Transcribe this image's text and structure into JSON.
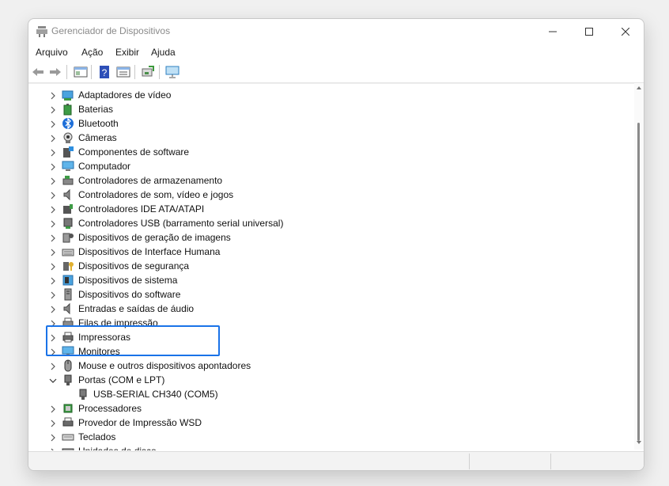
{
  "window": {
    "title": "Gerenciador de Dispositivos"
  },
  "menu": [
    "Arquivo",
    "Ação",
    "Exibir",
    "Ajuda"
  ],
  "tree": [
    {
      "label": "Adaptadores de vídeo",
      "icon": "display-adapter-icon"
    },
    {
      "label": "Baterias",
      "icon": "battery-icon"
    },
    {
      "label": "Bluetooth",
      "icon": "bluetooth-icon"
    },
    {
      "label": "Câmeras",
      "icon": "camera-icon"
    },
    {
      "label": "Componentes de software",
      "icon": "software-component-icon"
    },
    {
      "label": "Computador",
      "icon": "computer-icon"
    },
    {
      "label": "Controladores de armazenamento",
      "icon": "storage-controller-icon"
    },
    {
      "label": "Controladores de som, vídeo e jogos",
      "icon": "speaker-icon"
    },
    {
      "label": "Controladores IDE ATA/ATAPI",
      "icon": "ide-controller-icon"
    },
    {
      "label": "Controladores USB (barramento serial universal)",
      "icon": "usb-icon"
    },
    {
      "label": "Dispositivos de geração de imagens",
      "icon": "imaging-device-icon"
    },
    {
      "label": "Dispositivos de Interface Humana",
      "icon": "hid-icon"
    },
    {
      "label": "Dispositivos de segurança",
      "icon": "security-device-icon"
    },
    {
      "label": "Dispositivos de sistema",
      "icon": "system-device-icon"
    },
    {
      "label": "Dispositivos do software",
      "icon": "software-device-icon"
    },
    {
      "label": "Entradas e saídas de áudio",
      "icon": "audio-io-icon"
    },
    {
      "label": "Filas de impressão",
      "icon": "print-queue-icon"
    },
    {
      "label": "Impressoras",
      "icon": "printer-icon"
    },
    {
      "label": "Monitores",
      "icon": "monitor-icon"
    },
    {
      "label": "Mouse e outros dispositivos apontadores",
      "icon": "mouse-icon"
    },
    {
      "label": "Portas (COM e LPT)",
      "icon": "port-icon",
      "expanded": true
    },
    {
      "label": "USB-SERIAL CH340 (COM5)",
      "icon": "port-icon",
      "child": true
    },
    {
      "label": "Processadores",
      "icon": "processor-icon"
    },
    {
      "label": "Provedor de Impressão WSD",
      "icon": "wsd-printer-icon"
    },
    {
      "label": "Teclados",
      "icon": "keyboard-icon"
    },
    {
      "label": "Unidades de disco",
      "icon": "disk-drive-icon"
    }
  ],
  "colors": {
    "highlight": "#1a73e8",
    "accent": "#1e88e5"
  }
}
